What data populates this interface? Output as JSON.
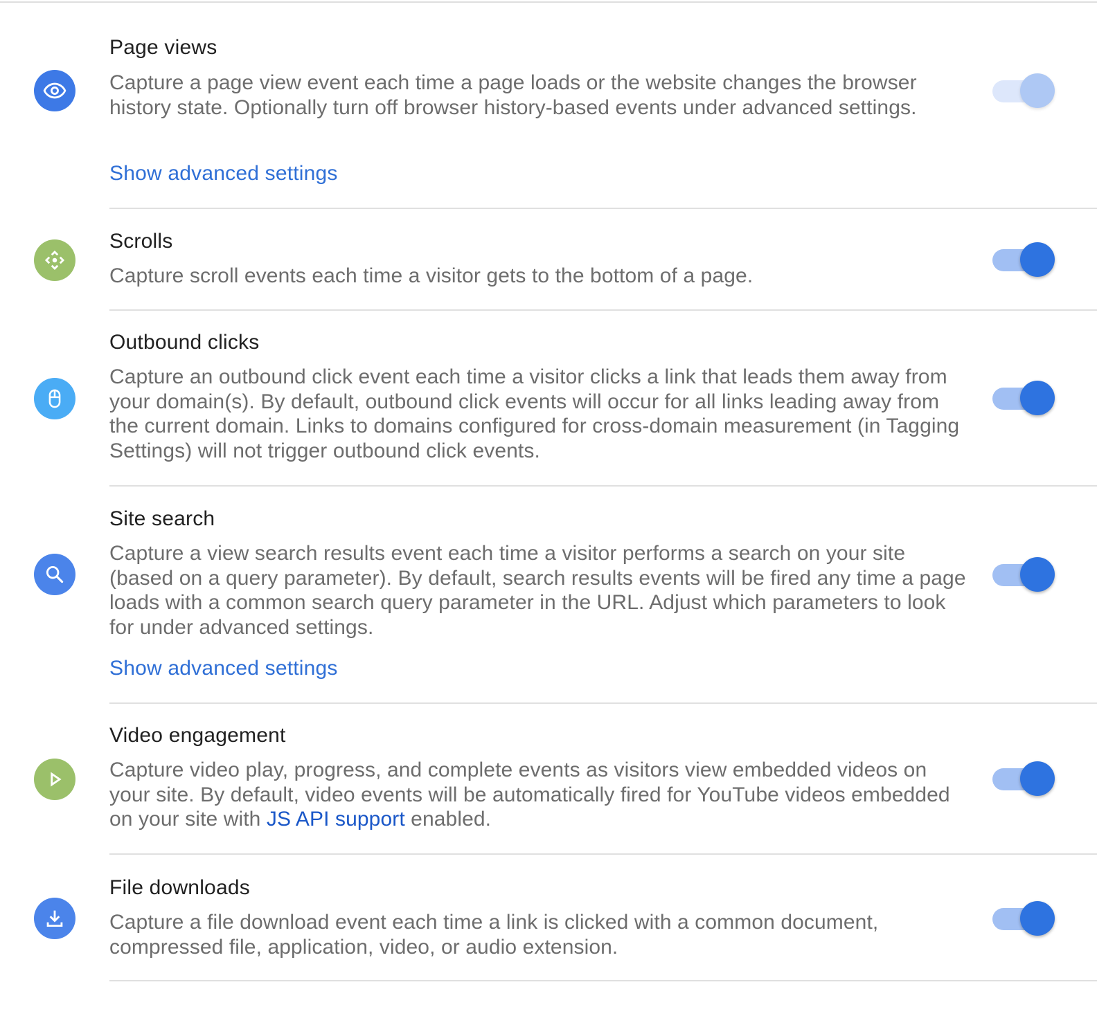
{
  "colors": {
    "blue_icon": "#3d79e6",
    "green_icon": "#9bc06a",
    "light_blue_icon": "#4aacf5",
    "search_icon_bg": "#4b84ea",
    "download_icon_bg": "#4b84ea",
    "toggle_on": "#2e73e0",
    "toggle_disabled": "#aec8f4",
    "link": "#2f6fd6"
  },
  "settings": [
    {
      "id": "page-views",
      "icon": "eye-icon",
      "title": "Page views",
      "description": "Capture a page view event each time a page loads or the website changes the browser history state. Optionally turn off browser history-based events under advanced settings.",
      "advanced_link": "Show advanced settings",
      "toggle": {
        "on": true,
        "disabled": true
      }
    },
    {
      "id": "scrolls",
      "icon": "scroll-arrows-icon",
      "title": "Scrolls",
      "description": "Capture scroll events each time a visitor gets to the bottom of a page.",
      "toggle": {
        "on": true,
        "disabled": false
      }
    },
    {
      "id": "outbound-clicks",
      "icon": "mouse-icon",
      "title": "Outbound clicks",
      "description": "Capture an outbound click event each time a visitor clicks a link that leads them away from your domain(s). By default, outbound click events will occur for all links leading away from the current domain. Links to domains configured for cross-domain measurement (in Tagging Settings) will not trigger outbound click events.",
      "toggle": {
        "on": true,
        "disabled": false
      }
    },
    {
      "id": "site-search",
      "icon": "search-icon",
      "title": "Site search",
      "description": "Capture a view search results event each time a visitor performs a search on your site (based on a query parameter). By default, search results events will be fired any time a page loads with a common search query parameter in the URL. Adjust which parameters to look for under advanced settings.",
      "advanced_link": "Show advanced settings",
      "toggle": {
        "on": true,
        "disabled": false
      }
    },
    {
      "id": "video-engagement",
      "icon": "play-icon",
      "title": "Video engagement",
      "description_before": "Capture video play, progress, and complete events as visitors view embedded videos on your site. By default, video events will be automatically fired for YouTube videos embedded on your site with ",
      "description_link": "JS API support",
      "description_after": " enabled.",
      "toggle": {
        "on": true,
        "disabled": false
      }
    },
    {
      "id": "file-downloads",
      "icon": "download-icon",
      "title": "File downloads",
      "description": "Capture a file download event each time a link is clicked with a common document, compressed file, application, video, or audio extension.",
      "toggle": {
        "on": true,
        "disabled": false
      }
    }
  ]
}
